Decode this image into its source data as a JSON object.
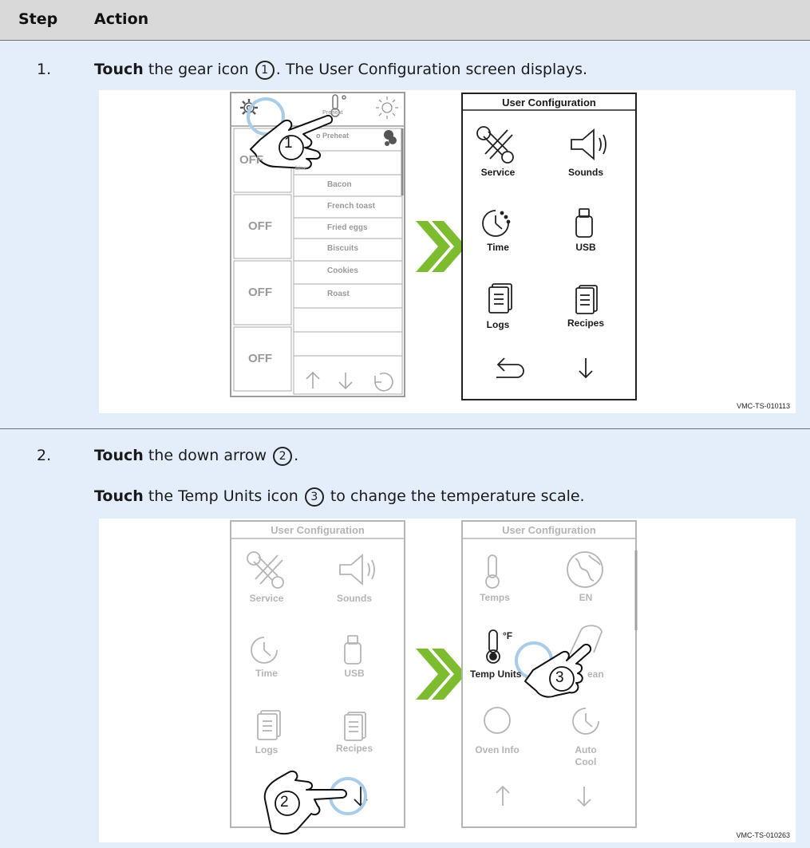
{
  "table": {
    "header": {
      "step": "Step",
      "action": "Action"
    },
    "rows": [
      {
        "number": "1.",
        "lines": [
          {
            "bold": "Touch",
            "pre": " the gear icon ",
            "callout": "1",
            "post": ". The User Configuration screen displays."
          }
        ],
        "figure_id": "VMC-TS-010113"
      },
      {
        "number": "2.",
        "lines": [
          {
            "bold": "Touch",
            "pre": " the down arrow ",
            "callout": "2",
            "post": "."
          },
          {
            "bold": "Touch",
            "pre": " the Temp Units icon ",
            "callout": "3",
            "post": " to change the temperature scale."
          }
        ],
        "figure_id": "VMC-TS-010263"
      }
    ]
  },
  "screen_home": {
    "preheat_label": "Preheat",
    "auto_preheat": "o Preheat",
    "off_label": "OFF",
    "menu_items": [
      "Bacon",
      "French toast",
      "Fried eggs",
      "Biscuits",
      "Cookies",
      "Roast"
    ],
    "fragment": "bine"
  },
  "screen_config_page1": {
    "title": "User Configuration",
    "items": [
      "Service",
      "Sounds",
      "Time",
      "USB",
      "Logs",
      "Recipes"
    ]
  },
  "screen_config_page2": {
    "title": "User Configuration",
    "items": [
      "Temps",
      "EN",
      "Temp Units",
      "ean",
      "Oven Info",
      "Auto Cool"
    ],
    "unit_symbol": "°F"
  },
  "callouts": {
    "one": "1",
    "two": "2",
    "three": "3"
  },
  "colors": {
    "arrow_green": "#7dbb2f",
    "touch_ring": "#a9cce8",
    "active_frame": "#222222",
    "faded": "#b5b5b5"
  }
}
